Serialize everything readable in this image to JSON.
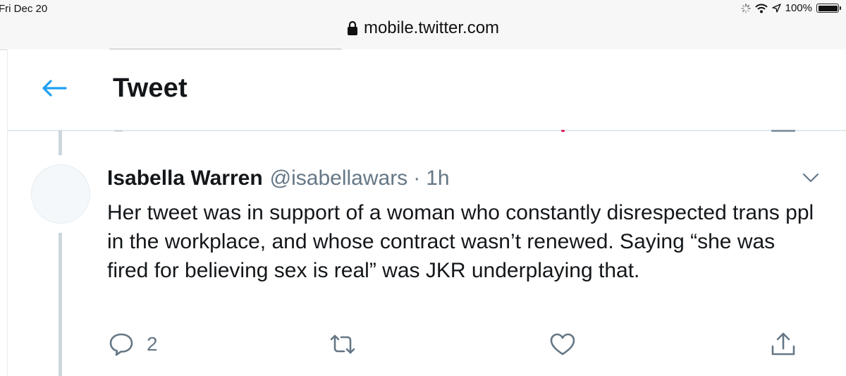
{
  "status_bar": {
    "time": "Fri Dec 20",
    "battery": "100%",
    "battery_level": 1.0
  },
  "browser": {
    "url": "mobile.twitter.com"
  },
  "header": {
    "title": "Tweet"
  },
  "tweet": {
    "author_name": "Isabella Warren",
    "author_handle": "@isabellawars",
    "separator": "·",
    "time": "1h",
    "text": "Her tweet was in support of a woman who constantly disrespected trans ppl in the workplace, and whose contract wasn’t renewed. Saying “she was fired for believing sex is real” was JKR underplaying that.",
    "reply_count": "2"
  },
  "colors": {
    "twitter_blue": "#1da1f2",
    "text_primary": "#14171a",
    "text_secondary": "#657786",
    "thread_line": "#ccd6dd"
  },
  "icons": {
    "back": "arrow-left-icon",
    "more": "chevron-down-icon",
    "reply": "speech-bubble-icon",
    "retweet": "retweet-icon",
    "like": "heart-icon",
    "share": "share-icon",
    "lock": "lock-icon"
  }
}
